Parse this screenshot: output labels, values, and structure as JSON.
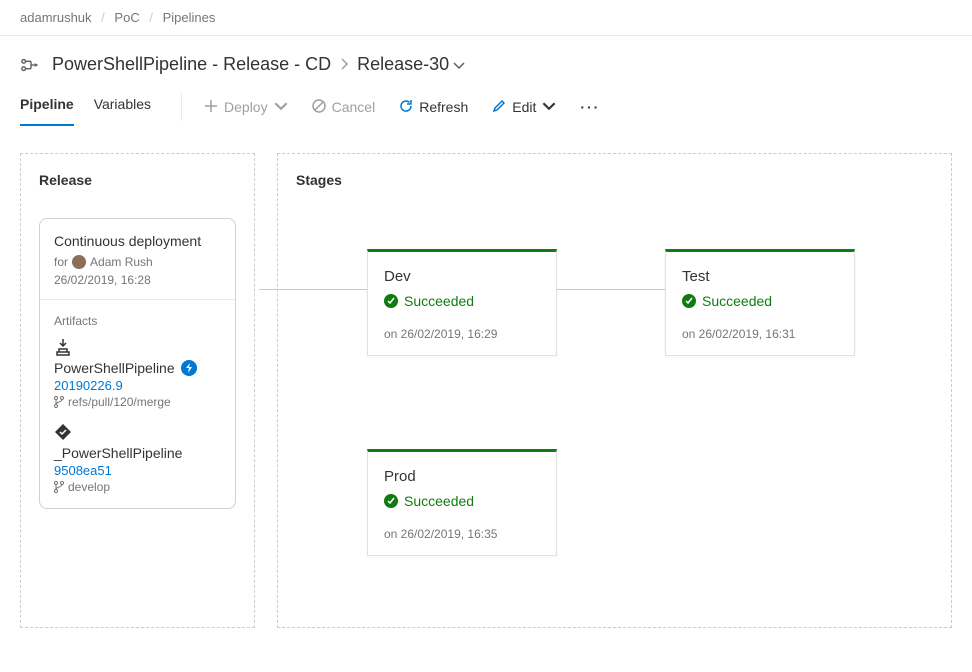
{
  "breadcrumb": {
    "org": "adamrushuk",
    "project": "PoC",
    "area": "Pipelines"
  },
  "title": {
    "pipeline": "PowerShellPipeline - Release - CD",
    "release": "Release-30"
  },
  "tabs": {
    "pipeline": "Pipeline",
    "variables": "Variables"
  },
  "toolbar": {
    "deploy": "Deploy",
    "cancel": "Cancel",
    "refresh": "Refresh",
    "edit": "Edit"
  },
  "releasePanel": {
    "heading": "Release",
    "cdTitle": "Continuous deployment",
    "forPrefix": "for",
    "requester": "Adam Rush",
    "created": "26/02/2019, 16:28",
    "artifactsLabel": "Artifacts",
    "artifacts": [
      {
        "name": "PowerShellPipeline",
        "version": "20190226.9",
        "branch": "refs/pull/120/merge",
        "badge": true,
        "iconType": "build"
      },
      {
        "name": "_PowerShellPipeline",
        "version": "9508ea51",
        "branch": "develop",
        "badge": false,
        "iconType": "repo"
      }
    ]
  },
  "stagesPanel": {
    "heading": "Stages",
    "succeeded": "Succeeded",
    "stages": [
      {
        "name": "Dev",
        "status": "Succeeded",
        "time": "on 26/02/2019, 16:29"
      },
      {
        "name": "Test",
        "status": "Succeeded",
        "time": "on 26/02/2019, 16:31"
      },
      {
        "name": "Prod",
        "status": "Succeeded",
        "time": "on 26/02/2019, 16:35"
      }
    ]
  }
}
